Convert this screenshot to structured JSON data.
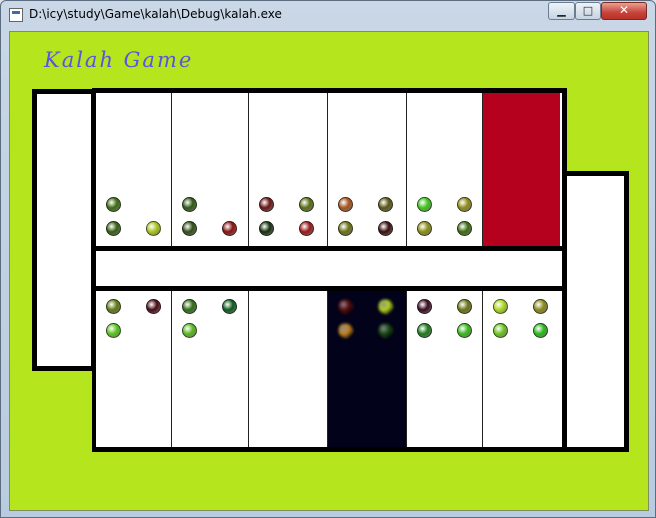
{
  "window": {
    "title": "D:\\icy\\study\\Game\\kalah\\Debug\\kalah.exe",
    "minimize_label": "▁",
    "maximize_label": "□",
    "close_label": "✕"
  },
  "game": {
    "title": "Kalah Game",
    "colors": {
      "background": "#b5e61d",
      "board_line": "#000000",
      "selected_pit": "#b5001e",
      "highlight_pit": "#02021a",
      "title_text": "#5a55e0"
    },
    "top_row": [
      {
        "seeds": [
          "#3d6b10",
          "#355f12",
          "#a8c51c"
        ],
        "state": "normal"
      },
      {
        "seeds": [
          "#2e5a14",
          "#2f4f16",
          "#8b1010"
        ],
        "state": "normal"
      },
      {
        "seeds": [
          "#6b1414",
          "#14300c",
          "#9a1818",
          "#5b6e14"
        ],
        "state": "normal"
      },
      {
        "seeds": [
          "#a8521c",
          "#6a7114",
          "#3a0c0c",
          "#5a5614"
        ],
        "state": "normal"
      },
      {
        "seeds": [
          "#3fc41c",
          "#8a8f16",
          "#3d6b10",
          "#8f8a1a"
        ],
        "state": "normal"
      },
      {
        "seeds": [],
        "state": "selected"
      }
    ],
    "bottom_row": [
      {
        "seeds": [
          "#5f7a14",
          "#4a0a14",
          "#5ac41c"
        ],
        "state": "normal"
      },
      {
        "seeds": [
          "#2e6e14",
          "#0d5a1a",
          "#5ab81c"
        ],
        "state": "normal"
      },
      {
        "seeds": [],
        "state": "normal"
      },
      {
        "seeds": [
          "#5a0c0c",
          "#b8d81a",
          "#c8861c",
          "#1a4a10"
        ],
        "state": "highlight"
      },
      {
        "seeds": [
          "#3a0a1e",
          "#6a7414",
          "#1f7a1c",
          "#3ab81c"
        ],
        "state": "normal"
      },
      {
        "seeds": [
          "#a8d81c",
          "#8a8a1a",
          "#6ac41c",
          "#2ab81c"
        ],
        "state": "normal"
      }
    ],
    "left_store_seeds": 0,
    "right_store_seeds": 0
  }
}
